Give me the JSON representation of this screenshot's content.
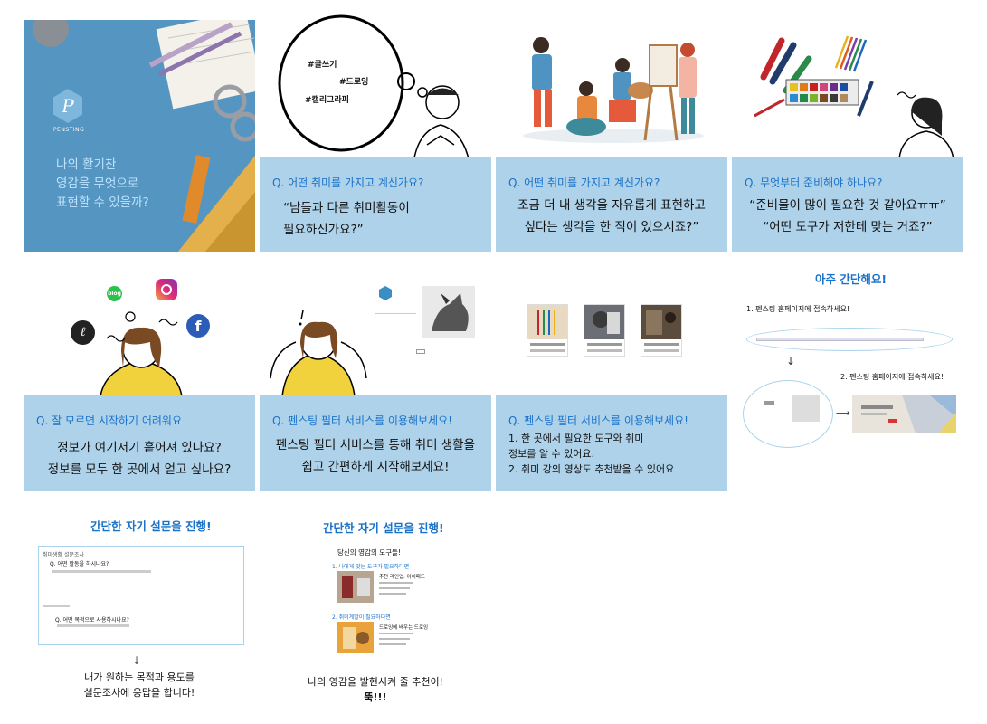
{
  "panel1": {
    "logo_letter": "P",
    "brand": "PENSTING",
    "headline": [
      "나의 활기찬",
      "영감을 무엇으로",
      "표현할 수 있을까?"
    ]
  },
  "panel2": {
    "tags": [
      "#글쓰기",
      "#드로잉",
      "#캘리그라피"
    ],
    "question": "Q. 어떤 취미를 가지고 계신가요?",
    "text": [
      "“남들과 다른 취미활동이",
      "필요하신가요?”"
    ]
  },
  "panel3": {
    "question": "Q. 어떤 취미를 가지고 계신가요?",
    "text": [
      "조금 더 내 생각을 자유롭게 표현하고",
      "싶다는 생각을 한 적이 있으시죠?”"
    ]
  },
  "panel4": {
    "question": "Q. 무엇부터 준비해야 하나요?",
    "text": [
      "“준비물이 많이 필요한 것 같아요ㅠㅠ”",
      "“어떤 도구가 저한테 맞는 거죠?”"
    ]
  },
  "panel5": {
    "icons": [
      "blog-icon",
      "instagram-icon",
      "pensting-icon",
      "facebook-icon"
    ],
    "blog_label": "blog",
    "question": "Q. 잘 모르면 시작하기 어려워요",
    "text": [
      "정보가 여기저기 흩어져 있나요?",
      "정보를 모두 한 곳에서 얻고 싶나요?"
    ]
  },
  "panel6": {
    "question": "Q. 펜스팅 필터 서비스를 이용해보세요!",
    "text": [
      "펜스팅 필터 서비스를 통해 취미 생활을",
      "쉽고 간편하게 시작해보세요!"
    ]
  },
  "panel7": {
    "question": "Q. 펜스팅 필터 서비스를 이용해보세요!",
    "text": [
      "1. 한 곳에서 필요한 도구와 취미",
      "정보를 알 수 있어요.",
      "2. 취미 강의 영상도 추천받을 수 있어요"
    ]
  },
  "panel8": {
    "title": "아주 간단해요!",
    "step1": "1. 펜스팅 홈페이지에 접속하세요!",
    "step2": "2. 펜스팅 홈페이지에 접속하세요!",
    "arrow": "↓",
    "arrow_right": "⟶"
  },
  "panel9": {
    "title": "간단한 자기 설문을 진행!",
    "form_heading": "취미생활 설문조사",
    "q1": "Q. 어떤 활동을 하시나요?",
    "q2": "Q. 어떤 목적으로 사용하시나요?",
    "arrow": "↓",
    "text": [
      "내가 원하는 목적과 용도를",
      "설문조사에 응답을 합니다!"
    ]
  },
  "panel10": {
    "title": "간단한 자기 설문을 진행!",
    "sub": "당신의 영감의 도구들!",
    "sec1": "1. 나에게 맞는 도구가 필요하다면",
    "item1": "추천 라인업: 아이패드",
    "sec2": "2. 취미계발이 필요하다면",
    "item2": "드로잉에 배우는 드로잉",
    "text": [
      "나의 영감을 발현시켜 줄 추천이!",
      "뚝!!!"
    ]
  },
  "colors": {
    "caption_bg": "#aed2ea",
    "accent": "#1a72c9",
    "panel1_bg": "#4d8fbd"
  }
}
